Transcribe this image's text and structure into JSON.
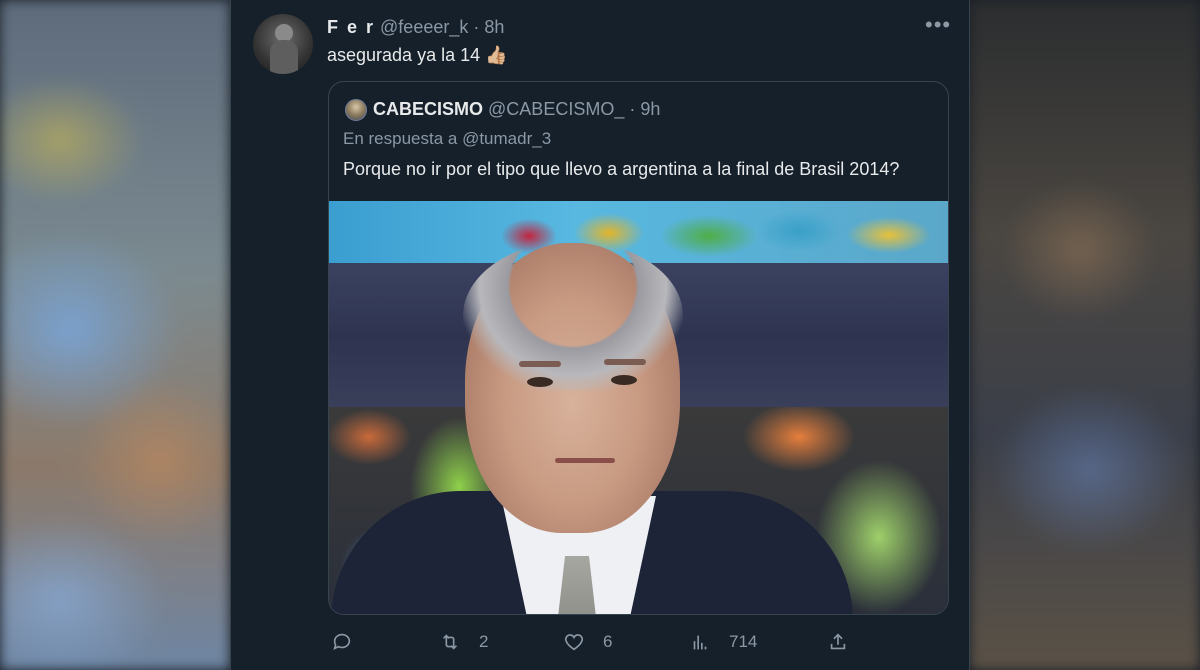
{
  "tweet": {
    "display_name": "F e r",
    "handle": "@feeeer_k",
    "separator": "·",
    "time": "8h",
    "text": "asegurada ya la 14",
    "emoji": "👍🏼"
  },
  "quoted": {
    "display_name": "CABECISMO",
    "handle": "@CABECISMO_",
    "separator": "·",
    "time": "9h",
    "reply_to": "En respuesta a @tumadr_3",
    "text": "Porque no ir por el tipo que llevo a argentina a la final de Brasil 2014?"
  },
  "actions": {
    "retweets": "2",
    "likes": "6",
    "views": "714"
  },
  "icons": [
    "more-icon",
    "reply-icon",
    "retweet-icon",
    "like-icon",
    "views-icon",
    "share-icon"
  ],
  "colors": {
    "background": "#15202b",
    "text": "#e7e9ea",
    "muted": "#8b98a5",
    "border": "#38444d"
  }
}
